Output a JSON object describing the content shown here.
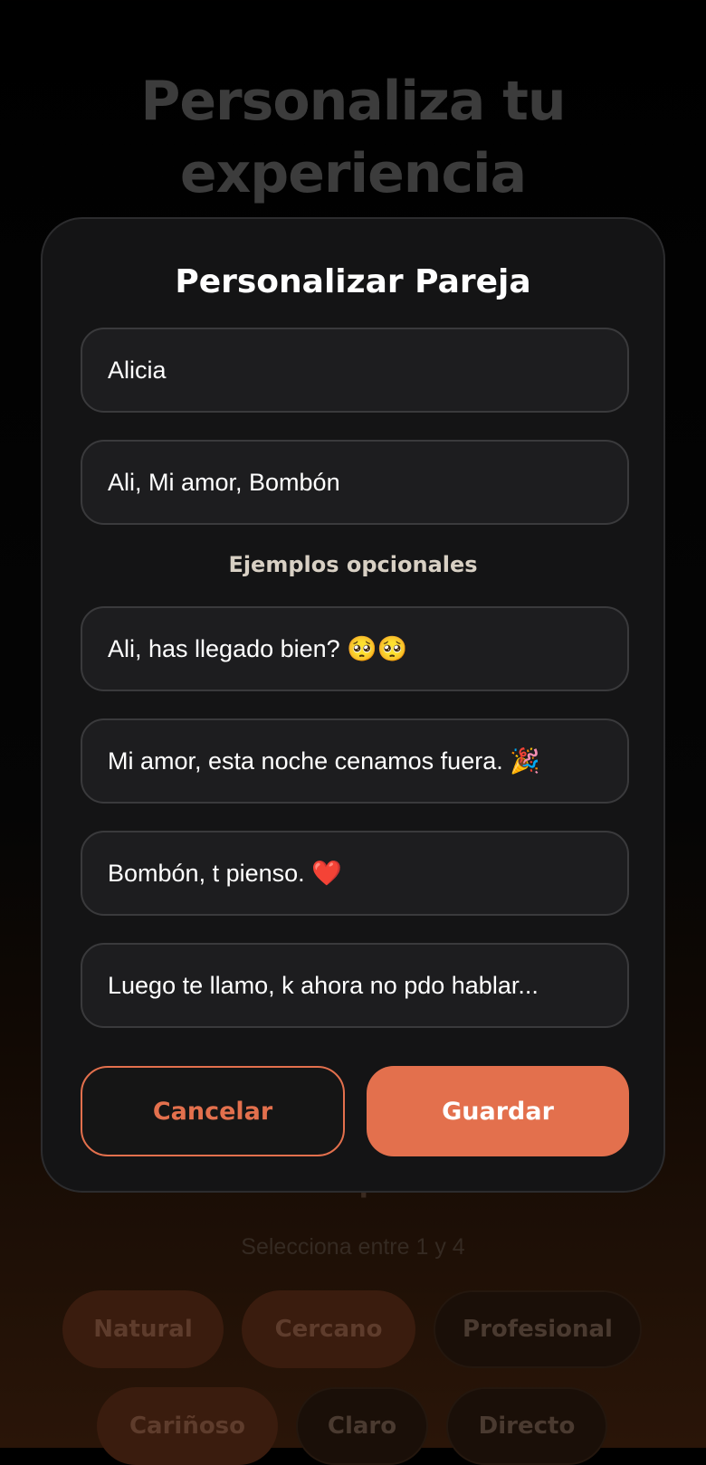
{
  "background": {
    "title": "Personaliza tu experiencia",
    "section_title": "Tonos disponibles",
    "section_subtitle": "Selecciona entre 1 y 4",
    "tones": [
      {
        "label": "Natural",
        "selected": true
      },
      {
        "label": "Cercano",
        "selected": true
      },
      {
        "label": "Profesional",
        "selected": false
      },
      {
        "label": "Cariñoso",
        "selected": true
      },
      {
        "label": "Claro",
        "selected": false
      },
      {
        "label": "Directo",
        "selected": false
      }
    ]
  },
  "modal": {
    "title": "Personalizar Pareja",
    "name_value": "Alicia",
    "nicknames_value": "Ali, Mi amor, Bombón",
    "examples_label": "Ejemplos opcionales",
    "examples": [
      "Ali, has llegado bien? 🥺🥺",
      "Mi amor, esta noche cenamos fuera. 🎉",
      "Bombón, t pienso. ❤️",
      "Luego te llamo, k ahora no pdo hablar..."
    ],
    "cancel_label": "Cancelar",
    "save_label": "Guardar"
  },
  "colors": {
    "accent": "#e3704d",
    "modal_bg": "#141415",
    "field_bg": "#1d1d1f"
  }
}
